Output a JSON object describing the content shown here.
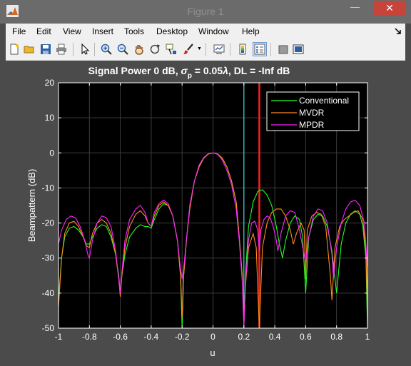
{
  "window": {
    "title": "Figure 1",
    "minimize_glyph": "—",
    "maximize_glyph": "☐",
    "close_glyph": "✕"
  },
  "menu": [
    "File",
    "Edit",
    "View",
    "Insert",
    "Tools",
    "Desktop",
    "Window",
    "Help"
  ],
  "toolbar_icons": [
    "new-figure-icon",
    "open-file-icon",
    "save-icon",
    "print-icon",
    "pointer-icon",
    "zoom-in-icon",
    "zoom-out-icon",
    "pan-icon",
    "rotate-3d-icon",
    "data-cursor-icon",
    "brush-icon",
    "link-plot-icon",
    "colorbar-icon",
    "legend-icon",
    "hide-plot-tools-icon",
    "show-plot-tools-icon"
  ],
  "colors": {
    "conventional": "#22ff22",
    "mvdr": "#ff8c1a",
    "mpdr": "#ff22ff",
    "steer_line": "#ff2020",
    "interferer_line": "#3ad6d6",
    "axes_bg": "#000000",
    "figure_bg": "#4b4b4b"
  },
  "chart_data": {
    "type": "line",
    "title_prefix": "Signal Power 0 dB, ",
    "title_sigma": "σ",
    "title_sub": "p",
    "title_mid": " = 0.05",
    "title_lambda": "λ",
    "title_suffix": ", DL = -Inf dB",
    "xlabel": "u",
    "ylabel": "Beampattern (dB)",
    "xlim": [
      -1,
      1
    ],
    "ylim": [
      -50,
      20
    ],
    "xticks": [
      -1,
      -0.8,
      -0.6,
      -0.4,
      -0.2,
      0,
      0.2,
      0.4,
      0.6,
      0.8,
      1
    ],
    "xtick_labels": [
      "-1",
      "-0.8",
      "-0.6",
      "-0.4",
      "-0.2",
      "0",
      "0.2",
      "0.4",
      "0.6",
      "0.8",
      "1"
    ],
    "yticks": [
      20,
      10,
      0,
      -10,
      -20,
      -30,
      -40,
      -50
    ],
    "ytick_labels": [
      "20",
      "10",
      "0",
      "-10",
      "-20",
      "-30",
      "-40",
      "-50"
    ],
    "grid": true,
    "legend_position": "top-right",
    "vertical_lines": [
      {
        "x": 0.2,
        "color": "interferer_line"
      },
      {
        "x": 0.3,
        "color": "steer_line"
      }
    ],
    "series": [
      {
        "name": "Conventional",
        "color": "conventional",
        "points": [
          [
            -1,
            -42
          ],
          [
            -0.98,
            -30
          ],
          [
            -0.96,
            -24
          ],
          [
            -0.93,
            -21.5
          ],
          [
            -0.9,
            -21
          ],
          [
            -0.87,
            -22
          ],
          [
            -0.84,
            -24
          ],
          [
            -0.82,
            -26
          ],
          [
            -0.8,
            -26
          ],
          [
            -0.78,
            -24
          ],
          [
            -0.75,
            -21.5
          ],
          [
            -0.72,
            -20.5
          ],
          [
            -0.69,
            -21
          ],
          [
            -0.66,
            -24
          ],
          [
            -0.63,
            -29
          ],
          [
            -0.61,
            -35
          ],
          [
            -0.6,
            -40
          ],
          [
            -0.59,
            -35
          ],
          [
            -0.57,
            -29
          ],
          [
            -0.54,
            -24
          ],
          [
            -0.5,
            -21.5
          ],
          [
            -0.47,
            -20.5
          ],
          [
            -0.44,
            -21
          ],
          [
            -0.42,
            -21
          ],
          [
            -0.4,
            -21.5
          ],
          [
            -0.38,
            -19
          ],
          [
            -0.35,
            -16
          ],
          [
            -0.32,
            -14.5
          ],
          [
            -0.29,
            -15
          ],
          [
            -0.26,
            -18
          ],
          [
            -0.23,
            -25
          ],
          [
            -0.21,
            -35
          ],
          [
            -0.2,
            -50
          ],
          [
            -0.19,
            -35
          ],
          [
            -0.17,
            -24
          ],
          [
            -0.15,
            -15
          ],
          [
            -0.12,
            -8
          ],
          [
            -0.09,
            -4
          ],
          [
            -0.06,
            -1.5
          ],
          [
            -0.03,
            -0.3
          ],
          [
            0,
            0
          ],
          [
            0.03,
            -0.3
          ],
          [
            0.06,
            -1.5
          ],
          [
            0.09,
            -4
          ],
          [
            0.12,
            -8
          ],
          [
            0.15,
            -14
          ],
          [
            0.17,
            -24
          ],
          [
            0.19,
            -35
          ],
          [
            0.2,
            -50
          ],
          [
            0.21,
            -35
          ],
          [
            0.23,
            -21
          ],
          [
            0.26,
            -14
          ],
          [
            0.29,
            -11
          ],
          [
            0.32,
            -10.5
          ],
          [
            0.35,
            -12
          ],
          [
            0.38,
            -15
          ],
          [
            0.41,
            -21
          ],
          [
            0.43,
            -26
          ],
          [
            0.45,
            -30
          ],
          [
            0.47,
            -25
          ],
          [
            0.5,
            -20
          ],
          [
            0.53,
            -18
          ],
          [
            0.56,
            -19
          ],
          [
            0.58,
            -24
          ],
          [
            0.6,
            -40
          ],
          [
            0.62,
            -24
          ],
          [
            0.65,
            -19
          ],
          [
            0.68,
            -17.5
          ],
          [
            0.71,
            -18
          ],
          [
            0.74,
            -21
          ],
          [
            0.77,
            -28
          ],
          [
            0.8,
            -40
          ],
          [
            0.83,
            -26
          ],
          [
            0.86,
            -20
          ],
          [
            0.89,
            -17.5
          ],
          [
            0.92,
            -16.5
          ],
          [
            0.95,
            -17.5
          ],
          [
            0.97,
            -21
          ],
          [
            0.99,
            -30
          ],
          [
            1,
            -50
          ]
        ]
      },
      {
        "name": "MVDR",
        "color": "mvdr",
        "points": [
          [
            -1,
            -44
          ],
          [
            -0.98,
            -30
          ],
          [
            -0.96,
            -23
          ],
          [
            -0.93,
            -20
          ],
          [
            -0.9,
            -19.5
          ],
          [
            -0.87,
            -21
          ],
          [
            -0.84,
            -24
          ],
          [
            -0.82,
            -26.5
          ],
          [
            -0.8,
            -27
          ],
          [
            -0.78,
            -23
          ],
          [
            -0.75,
            -20
          ],
          [
            -0.72,
            -19
          ],
          [
            -0.69,
            -20
          ],
          [
            -0.66,
            -23
          ],
          [
            -0.63,
            -29
          ],
          [
            -0.61,
            -36
          ],
          [
            -0.6,
            -41
          ],
          [
            -0.59,
            -35
          ],
          [
            -0.57,
            -27
          ],
          [
            -0.54,
            -21
          ],
          [
            -0.5,
            -17.5
          ],
          [
            -0.47,
            -16.5
          ],
          [
            -0.44,
            -18
          ],
          [
            -0.42,
            -20
          ],
          [
            -0.4,
            -21
          ],
          [
            -0.38,
            -18
          ],
          [
            -0.35,
            -15
          ],
          [
            -0.32,
            -14
          ],
          [
            -0.29,
            -15
          ],
          [
            -0.26,
            -18
          ],
          [
            -0.23,
            -25
          ],
          [
            -0.21,
            -35
          ],
          [
            -0.2,
            -47
          ],
          [
            -0.19,
            -35
          ],
          [
            -0.17,
            -24
          ],
          [
            -0.15,
            -16
          ],
          [
            -0.12,
            -8
          ],
          [
            -0.09,
            -4
          ],
          [
            -0.06,
            -1.5
          ],
          [
            -0.03,
            -0.3
          ],
          [
            0,
            0
          ],
          [
            0.03,
            -0.3
          ],
          [
            0.06,
            -1.5
          ],
          [
            0.09,
            -4
          ],
          [
            0.12,
            -8
          ],
          [
            0.15,
            -14
          ],
          [
            0.17,
            -24
          ],
          [
            0.19,
            -36
          ],
          [
            0.2,
            -48
          ],
          [
            0.21,
            -38
          ],
          [
            0.23,
            -27
          ],
          [
            0.26,
            -23
          ],
          [
            0.28,
            -27
          ],
          [
            0.3,
            -50
          ],
          [
            0.32,
            -27
          ],
          [
            0.35,
            -20
          ],
          [
            0.38,
            -17
          ],
          [
            0.41,
            -16
          ],
          [
            0.44,
            -16
          ],
          [
            0.47,
            -18
          ],
          [
            0.5,
            -22
          ],
          [
            0.52,
            -26
          ],
          [
            0.54,
            -23
          ],
          [
            0.57,
            -20
          ],
          [
            0.59,
            -22
          ],
          [
            0.6,
            -36
          ],
          [
            0.61,
            -22
          ],
          [
            0.64,
            -18
          ],
          [
            0.67,
            -17
          ],
          [
            0.7,
            -17.5
          ],
          [
            0.73,
            -21
          ],
          [
            0.76,
            -35
          ],
          [
            0.77,
            -42
          ],
          [
            0.79,
            -27
          ],
          [
            0.82,
            -21
          ],
          [
            0.85,
            -19
          ],
          [
            0.88,
            -18
          ],
          [
            0.91,
            -17
          ],
          [
            0.94,
            -16.5
          ],
          [
            0.97,
            -19
          ],
          [
            0.99,
            -28
          ],
          [
            1,
            -45
          ]
        ]
      },
      {
        "name": "MPDR",
        "color": "mpdr",
        "points": [
          [
            -1,
            -26
          ],
          [
            -0.98,
            -22
          ],
          [
            -0.95,
            -19
          ],
          [
            -0.92,
            -18
          ],
          [
            -0.89,
            -18.5
          ],
          [
            -0.86,
            -21
          ],
          [
            -0.83,
            -25
          ],
          [
            -0.81,
            -29
          ],
          [
            -0.8,
            -30
          ],
          [
            -0.78,
            -25
          ],
          [
            -0.75,
            -20
          ],
          [
            -0.72,
            -18
          ],
          [
            -0.69,
            -18.5
          ],
          [
            -0.66,
            -21
          ],
          [
            -0.63,
            -28
          ],
          [
            -0.61,
            -36
          ],
          [
            -0.6,
            -40
          ],
          [
            -0.59,
            -34
          ],
          [
            -0.57,
            -25
          ],
          [
            -0.54,
            -19
          ],
          [
            -0.5,
            -16
          ],
          [
            -0.47,
            -15
          ],
          [
            -0.44,
            -17
          ],
          [
            -0.42,
            -20
          ],
          [
            -0.4,
            -21
          ],
          [
            -0.38,
            -17
          ],
          [
            -0.35,
            -14.5
          ],
          [
            -0.32,
            -13.5
          ],
          [
            -0.29,
            -14.5
          ],
          [
            -0.26,
            -18
          ],
          [
            -0.23,
            -25
          ],
          [
            -0.21,
            -33
          ],
          [
            -0.2,
            -36
          ],
          [
            -0.19,
            -33
          ],
          [
            -0.17,
            -24
          ],
          [
            -0.15,
            -15
          ],
          [
            -0.12,
            -8
          ],
          [
            -0.09,
            -3.5
          ],
          [
            -0.06,
            -1.3
          ],
          [
            -0.03,
            -0.2
          ],
          [
            0,
            0
          ],
          [
            0.03,
            -0.4
          ],
          [
            0.06,
            -2
          ],
          [
            0.09,
            -5
          ],
          [
            0.12,
            -9
          ],
          [
            0.15,
            -16
          ],
          [
            0.17,
            -25
          ],
          [
            0.19,
            -37
          ],
          [
            0.2,
            -50
          ],
          [
            0.21,
            -37
          ],
          [
            0.23,
            -25
          ],
          [
            0.25,
            -20
          ],
          [
            0.27,
            -19.5
          ],
          [
            0.29,
            -22
          ],
          [
            0.3,
            -28
          ],
          [
            0.31,
            -22
          ],
          [
            0.33,
            -19
          ],
          [
            0.35,
            -18
          ],
          [
            0.37,
            -18.5
          ],
          [
            0.39,
            -21
          ],
          [
            0.41,
            -25
          ],
          [
            0.42,
            -28
          ],
          [
            0.44,
            -23
          ],
          [
            0.47,
            -18
          ],
          [
            0.5,
            -16.5
          ],
          [
            0.53,
            -17
          ],
          [
            0.56,
            -22
          ],
          [
            0.59,
            -29
          ],
          [
            0.6,
            -31
          ],
          [
            0.62,
            -24
          ],
          [
            0.65,
            -18
          ],
          [
            0.68,
            -16
          ],
          [
            0.71,
            -16.5
          ],
          [
            0.74,
            -20
          ],
          [
            0.77,
            -29
          ],
          [
            0.78,
            -36
          ],
          [
            0.8,
            -27
          ],
          [
            0.83,
            -20
          ],
          [
            0.86,
            -16
          ],
          [
            0.89,
            -14
          ],
          [
            0.92,
            -13.5
          ],
          [
            0.95,
            -15
          ],
          [
            0.98,
            -20
          ],
          [
            1,
            -33
          ]
        ]
      }
    ]
  }
}
